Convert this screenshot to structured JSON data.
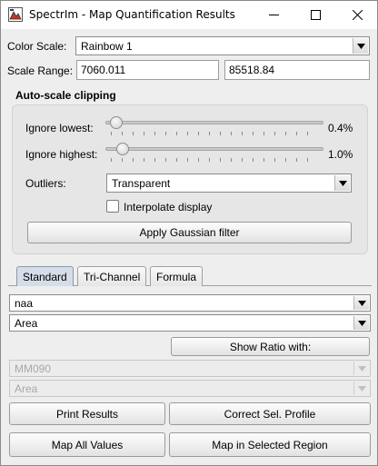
{
  "window": {
    "title": "SpectrIm - Map Quantification Results",
    "minimize_icon": "minimize-icon",
    "maximize_icon": "maximize-icon",
    "close_icon": "close-icon"
  },
  "color_scale": {
    "label": "Color Scale:",
    "value": "Rainbow 1"
  },
  "scale_range": {
    "label": "Scale Range:",
    "min": "7060.011",
    "max": "85518.84"
  },
  "auto_scale": {
    "title": "Auto-scale clipping",
    "ignore_lowest": {
      "label": "Ignore lowest:",
      "value_text": "0.4%",
      "fraction": 0.004
    },
    "ignore_highest": {
      "label": "Ignore highest:",
      "value_text": "1.0%",
      "fraction": 0.01
    },
    "outliers": {
      "label": "Outliers:",
      "value": "Transparent"
    },
    "interpolate": {
      "label": "Interpolate display",
      "checked": false
    },
    "gaussian_button": "Apply Gaussian filter"
  },
  "tabs": [
    {
      "label": "Standard",
      "active": true
    },
    {
      "label": "Tri-Channel",
      "active": false
    },
    {
      "label": "Formula",
      "active": false
    }
  ],
  "standard": {
    "element_select": "naa",
    "measure_select": "Area",
    "show_ratio_button": "Show Ratio with:",
    "ratio_element_select": "MM090",
    "ratio_measure_select": "Area"
  },
  "buttons": {
    "print_results": "Print Results",
    "correct_profile": "Correct Sel. Profile",
    "map_all": "Map All Values",
    "map_region": "Map in Selected Region"
  }
}
